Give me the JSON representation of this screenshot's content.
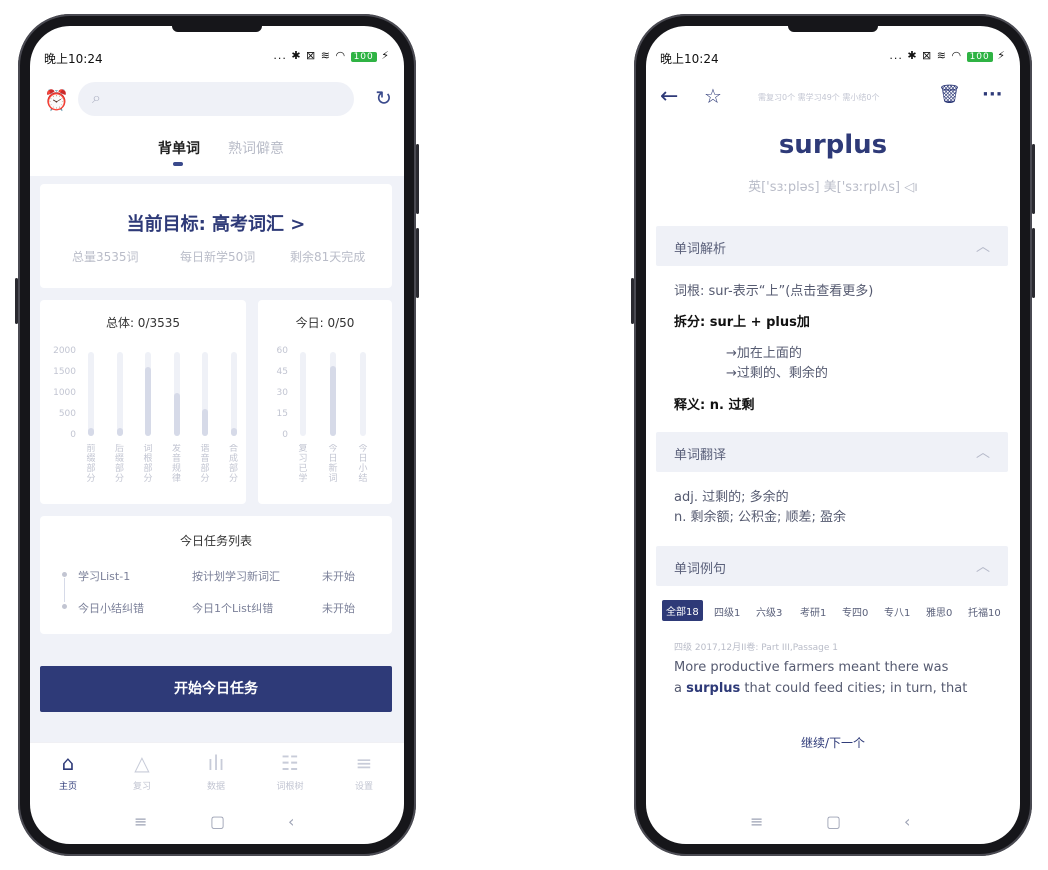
{
  "status": {
    "time": "晚上10:24",
    "battery": "100",
    "icons": "... ✱ ⊠ ≋"
  },
  "left": {
    "tabs": [
      "背单词",
      "熟词僻意"
    ],
    "goal": {
      "title": "当前目标: 高考词汇 >",
      "total": "总量3535词",
      "daily": "每日新学50词",
      "remaining": "剩余81天完成"
    },
    "overall_title": "总体: 0/3535",
    "today_title": "今日: 0/50",
    "tasks": {
      "title": "今日任务列表",
      "rows": [
        {
          "name": "学习List-1",
          "desc": "按计划学习新词汇",
          "status": "未开始"
        },
        {
          "name": "今日小结纠错",
          "desc": "今日1个List纠错",
          "status": "未开始"
        }
      ]
    },
    "start_button": "开始今日任务",
    "nav": [
      "主页",
      "复习",
      "数据",
      "词根树",
      "设置"
    ]
  },
  "chart_data": [
    {
      "type": "bar",
      "title": "总体: 0/3535",
      "categories": [
        "前缀部分",
        "后缀部分",
        "词根部分",
        "发音规律",
        "谐音部分",
        "合成部分"
      ],
      "values": [
        200,
        180,
        1650,
        1020,
        650,
        200
      ],
      "ylim": [
        0,
        2000
      ],
      "yticks": [
        "2000",
        "1500",
        "1000",
        "500",
        "0"
      ]
    },
    {
      "type": "bar",
      "title": "今日: 0/50",
      "categories": [
        "复习已学",
        "今日新词",
        "今日小结"
      ],
      "values": [
        0,
        50,
        0
      ],
      "ylim": [
        0,
        60
      ],
      "yticks": [
        "60",
        "45",
        "30",
        "15",
        "0"
      ]
    }
  ],
  "right": {
    "counts": "需复习0个  需学习49个  需小结0个",
    "word": "surplus",
    "phonetic": "英['sɜːpləs] 美['sɜːrplʌs]",
    "sections": [
      "单词解析",
      "单词翻译",
      "单词例句"
    ],
    "root": "词根: sur-表示“上”(点击查看更多)",
    "split": "拆分: sur上 + plus加",
    "arrow1": "→加在上面的",
    "arrow2": "→过剩的、剩余的",
    "meaning": "释义: n. 过剩",
    "trans1": "adj. 过剩的; 多余的",
    "trans2": "n. 剩余额; 公积金; 顺差; 盈余",
    "filters": [
      "全部18",
      "四级1",
      "六级3",
      "考研1",
      "专四0",
      "专八1",
      "雅思0",
      "托福10"
    ],
    "example_source": "四级 2017,12月II卷: Part III,Passage 1",
    "example_line1": "More productive farmers meant there was",
    "example_pre": "a ",
    "example_word": "surplus",
    "example_post": " that could feed cities; in turn, that",
    "continue": "继续/下一个"
  }
}
